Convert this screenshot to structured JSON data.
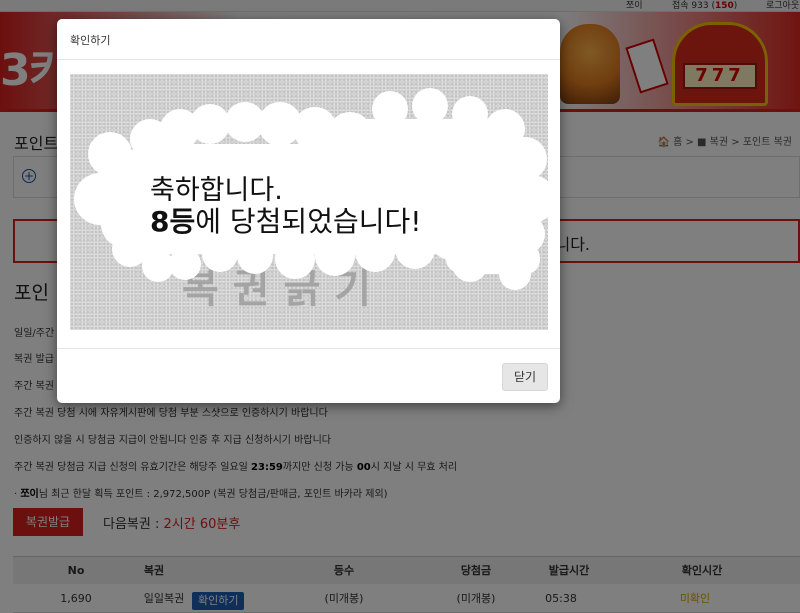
{
  "topbar": {
    "user": "쪼이",
    "visitors_prefix": "접속 933 (",
    "visitors_count": "150",
    "visitors_suffix": ")",
    "logout": "로그아웃"
  },
  "banner": {
    "logo_text": "3키",
    "slot_text": "777"
  },
  "page": {
    "section_title": "포인트",
    "breadcrumb": "🏠 홈 > ■ 복권 > 포인트 복권",
    "notice_tail": "니다.",
    "point_heading": "포인",
    "rules": [
      "일일/주간",
      "복권 발급",
      "주간 복권",
      "주간 복권 당첨 시에 자유게시판에 당첨 부분 스샷으로 인증하시기 바랍니다",
      "인증하지 않을 시 당첨금 지급이 안됩니다 인증 후 지급 신청하시기 바랍니다"
    ],
    "rule_validity_prefix": "주간 복권 당첨금 지급 신청의 유효기간은 해당주 일요일 ",
    "rule_validity_time": "23:59",
    "rule_validity_mid": "까지만 신청 가능 ",
    "rule_validity_zero": "00",
    "rule_validity_suffix": "시 지날 시 무효 처리",
    "summary_prefix": "· ",
    "summary_user": "쪼이",
    "summary_rest": "님 최근 한달 획득 포인트 : 2,972,500P (복권 당첨금/판매금, 포인트 바카라 제외)",
    "issue_button": "복권발급",
    "next_label": "다음복권 : ",
    "next_value": "2시간 60분후",
    "table": {
      "headers": [
        "No",
        "복권",
        "등수",
        "당첨금",
        "발급시간",
        "확인시간"
      ],
      "rows": [
        {
          "no": "1,690",
          "type": "일일복권",
          "action": "확인하기",
          "rank": "(미개봉)",
          "prize": "(미개봉)",
          "issued": "05:38",
          "checked": "미확인"
        }
      ]
    }
  },
  "modal": {
    "title": "확인하기",
    "line1": "축하합니다.",
    "line2_bold": "8등",
    "line2_rest": "에 당첨되었습니다!",
    "scratch_hint": "복권긁기",
    "close_button": "닫기"
  }
}
